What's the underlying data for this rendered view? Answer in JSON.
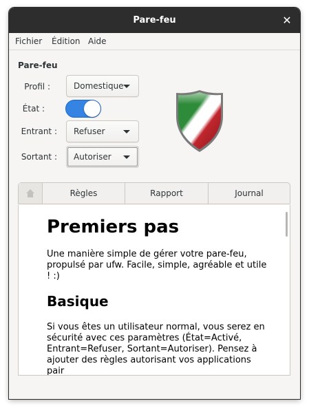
{
  "window": {
    "title": "Pare-feu",
    "close_glyph": "✕"
  },
  "menubar": {
    "items": [
      "Fichier",
      "Édition",
      "Aide"
    ]
  },
  "settings": {
    "heading": "Pare-feu",
    "profile_label": "Profil :",
    "profile_value": "Domestique",
    "state_label": "État :",
    "state_on": true,
    "incoming_label": "Entrant :",
    "incoming_value": "Refuser",
    "outgoing_label": "Sortant :",
    "outgoing_value": "Autoriser"
  },
  "tabs": {
    "home_icon": "home-icon",
    "items": [
      "Règles",
      "Rapport",
      "Journal"
    ]
  },
  "doc": {
    "h1": "Premiers pas",
    "p1": "Une manière simple de gérer votre pare-feu, propulsé par ufw. Facile, simple, agréable et utile ! :)",
    "h2": "Basique",
    "p2": "Si vous êtes un utilisateur normal, vous serez en sécurité avec ces paramètres (État=Activé, Entrant=Refuser, Sortant=Autoriser). Pensez à ajouter des règles autorisant vos applications pair"
  },
  "colors": {
    "accent": "#3584e4",
    "titlebar": "#2d2d2d",
    "shield_green": "#2e8b3a",
    "shield_red": "#c0262d"
  }
}
